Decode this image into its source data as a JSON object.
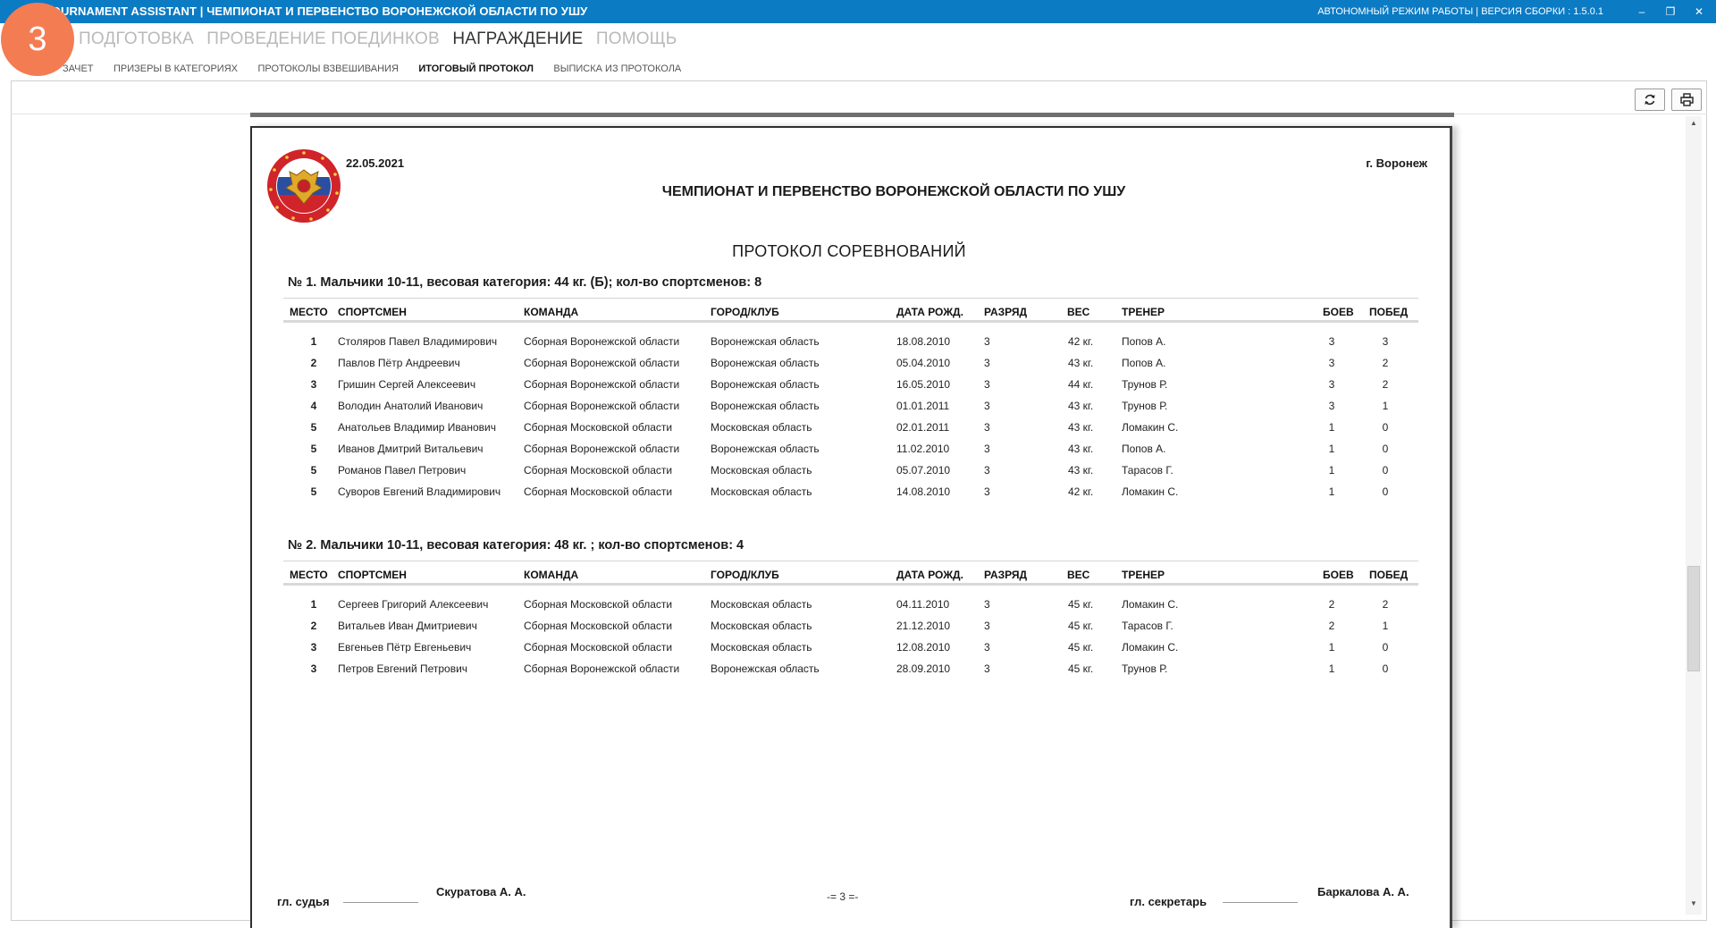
{
  "window": {
    "title": "TOURNAMENT ASSISTANT | ЧЕМПИОНАТ И ПЕРВЕНСТВО ВОРОНЕЖСКОЙ ОБЛАСТИ ПО УШУ",
    "status": "АВТОНОМНЫЙ РЕЖИМ РАБОТЫ  |  ВЕРСИЯ СБОРКИ : 1.5.0.1",
    "minimize": "‒",
    "restore": "❐",
    "close": "✕"
  },
  "step_badge": "3",
  "main_tabs": [
    {
      "label": "ПОДГОТОВКА"
    },
    {
      "label": "ПРОВЕДЕНИЕ ПОЕДИНКОВ"
    },
    {
      "label": "НАГРАЖДЕНИЕ"
    },
    {
      "label": "ПОМОЩЬ"
    }
  ],
  "sub_tabs": [
    {
      "label": "ЗАЧЕТ"
    },
    {
      "label": "ПРИЗЕРЫ В КАТЕГОРИЯХ"
    },
    {
      "label": "ПРОТОКОЛЫ ВЗВЕШИВАНИЯ"
    },
    {
      "label": "ИТОГОВЫЙ ПРОТОКОЛ"
    },
    {
      "label": "ВЫПИСКА ИЗ ПРОТОКОЛА"
    }
  ],
  "toolbar": {
    "refresh_icon": "refresh-icon",
    "print_icon": "printer-icon"
  },
  "document": {
    "date": "22.05.2021",
    "city": "г. Воронеж",
    "title": "ЧЕМПИОНАТ И ПЕРВЕНСТВО ВОРОНЕЖСКОЙ ОБЛАСТИ ПО УШУ",
    "subtitle": "ПРОТОКОЛ СОРЕВНОВАНИЙ",
    "columns": {
      "place": "МЕСТО",
      "athlete": "СПОРТСМЕН",
      "team": "КОМАНДА",
      "city": "ГОРОД/КЛУБ",
      "birth": "ДАТА РОЖД.",
      "rank": "РАЗРЯД",
      "weight": "ВЕС",
      "coach": "ТРЕНЕР",
      "fights": "БОЕВ",
      "wins": "ПОБЕД"
    },
    "categories": [
      {
        "heading": "№ 1. Мальчики 10-11, весовая категория: 44 кг. (Б); кол-во спортсменов: 8",
        "rows": [
          {
            "place": "1",
            "name": "Столяров Павел Владимирович",
            "team": "Сборная Воронежской области",
            "city": "Воронежская область",
            "birth": "18.08.2010",
            "rank": "3",
            "weight": "42 кг.",
            "coach": "Попов А.",
            "fights": "3",
            "wins": "3"
          },
          {
            "place": "2",
            "name": "Павлов Пётр Андреевич",
            "team": "Сборная Воронежской области",
            "city": "Воронежская область",
            "birth": "05.04.2010",
            "rank": "3",
            "weight": "43 кг.",
            "coach": "Попов А.",
            "fights": "3",
            "wins": "2"
          },
          {
            "place": "3",
            "name": "Гришин Сергей Алексеевич",
            "team": "Сборная Воронежской области",
            "city": "Воронежская область",
            "birth": "16.05.2010",
            "rank": "3",
            "weight": "44 кг.",
            "coach": "Трунов Р.",
            "fights": "3",
            "wins": "2"
          },
          {
            "place": "4",
            "name": "Володин Анатолий Иванович",
            "team": "Сборная Воронежской области",
            "city": "Воронежская область",
            "birth": "01.01.2011",
            "rank": "3",
            "weight": "43 кг.",
            "coach": "Трунов Р.",
            "fights": "3",
            "wins": "1"
          },
          {
            "place": "5",
            "name": "Анатольев Владимир Иванович",
            "team": "Сборная Московской области",
            "city": "Московская область",
            "birth": "02.01.2011",
            "rank": "3",
            "weight": "43 кг.",
            "coach": "Ломакин С.",
            "fights": "1",
            "wins": "0"
          },
          {
            "place": "5",
            "name": "Иванов Дмитрий Витальевич",
            "team": "Сборная Воронежской области",
            "city": "Воронежская область",
            "birth": "11.02.2010",
            "rank": "3",
            "weight": "43 кг.",
            "coach": "Попов А.",
            "fights": "1",
            "wins": "0"
          },
          {
            "place": "5",
            "name": "Романов Павел Петрович",
            "team": "Сборная Московской области",
            "city": "Московская область",
            "birth": "05.07.2010",
            "rank": "3",
            "weight": "43 кг.",
            "coach": "Тарасов Г.",
            "fights": "1",
            "wins": "0"
          },
          {
            "place": "5",
            "name": "Суворов Евгений Владимирович",
            "team": "Сборная Московской области",
            "city": "Московская область",
            "birth": "14.08.2010",
            "rank": "3",
            "weight": "42 кг.",
            "coach": "Ломакин С.",
            "fights": "1",
            "wins": "0"
          }
        ]
      },
      {
        "heading": "№ 2. Мальчики 10-11, весовая категория: 48 кг. ; кол-во спортсменов: 4",
        "rows": [
          {
            "place": "1",
            "name": "Сергеев Григорий Алексеевич",
            "team": "Сборная Московской области",
            "city": "Московская область",
            "birth": "04.11.2010",
            "rank": "3",
            "weight": "45 кг.",
            "coach": "Ломакин С.",
            "fights": "2",
            "wins": "2"
          },
          {
            "place": "2",
            "name": "Витальев Иван Дмитриевич",
            "team": "Сборная Московской области",
            "city": "Московская область",
            "birth": "21.12.2010",
            "rank": "3",
            "weight": "45 кг.",
            "coach": "Тарасов Г.",
            "fights": "2",
            "wins": "1"
          },
          {
            "place": "3",
            "name": "Евгеньев Пётр Евгеньевич",
            "team": "Сборная Московской области",
            "city": "Московская область",
            "birth": "12.08.2010",
            "rank": "3",
            "weight": "45 кг.",
            "coach": "Ломакин С.",
            "fights": "1",
            "wins": "0"
          },
          {
            "place": "3",
            "name": "Петров Евгений Петрович",
            "team": "Сборная Воронежской области",
            "city": "Воронежская область",
            "birth": "28.09.2010",
            "rank": "3",
            "weight": "45 кг.",
            "coach": "Трунов Р.",
            "fights": "1",
            "wins": "0"
          }
        ]
      }
    ],
    "footer": {
      "judge_label": "гл. судья",
      "judge_name": "Скуратова А. А.",
      "page": "-= 3 =-",
      "secretary_label": "гл. секретарь",
      "secretary_name": "Баркалова А. А."
    }
  },
  "colors": {
    "titlebar": "#0b7bc4",
    "badge": "#f47c52",
    "emblem_red": "#d0242a"
  }
}
